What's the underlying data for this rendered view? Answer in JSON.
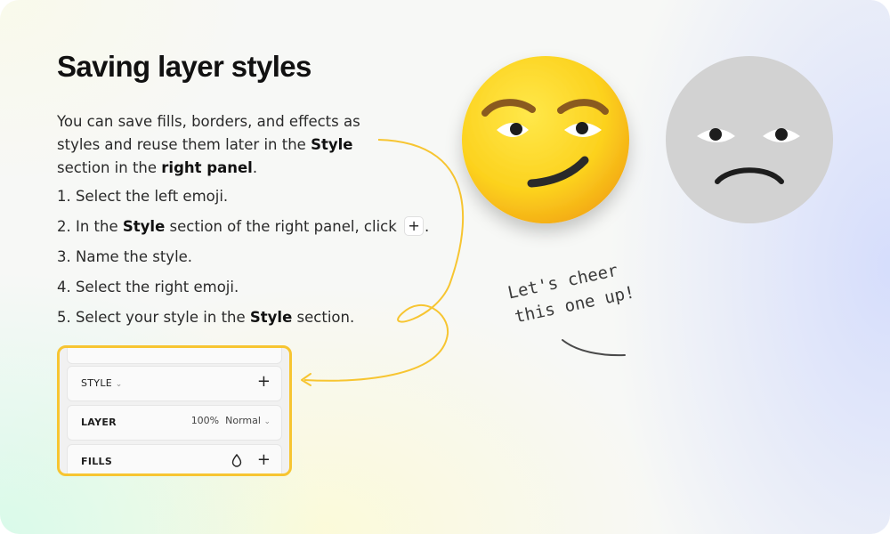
{
  "title": "Saving layer styles",
  "intro": {
    "text1": "You can save fills, borders, and effects as styles and reuse them later in the ",
    "bold1": "Style",
    "text2": " section in the ",
    "bold2": "right panel",
    "text3": "."
  },
  "steps": [
    {
      "text": "1. Select the left emoji."
    },
    {
      "pre": "2. In the ",
      "bold": "Style",
      "post": " section of the right panel, click ",
      "icon": "+",
      "end": "."
    },
    {
      "text": "3. Name the style."
    },
    {
      "text": "4. Select the right emoji."
    },
    {
      "pre": "5. Select your style in the ",
      "bold": "Style",
      "post": " section."
    }
  ],
  "panel": {
    "style_label": "STYLE",
    "style_plus": "+",
    "layer_label": "LAYER",
    "layer_opacity": "100%",
    "layer_blend": "Normal",
    "fills_label": "FILLS",
    "fills_plus": "+"
  },
  "note": {
    "line1": "Let's cheer",
    "line2": "this one up!"
  },
  "colors": {
    "highlight": "#f7c531",
    "emoji_yellow": "#fcd21e",
    "emoji_gray": "#d2d2d2"
  },
  "icons": [
    "plus-icon",
    "chevron-down-icon",
    "drop-icon"
  ]
}
